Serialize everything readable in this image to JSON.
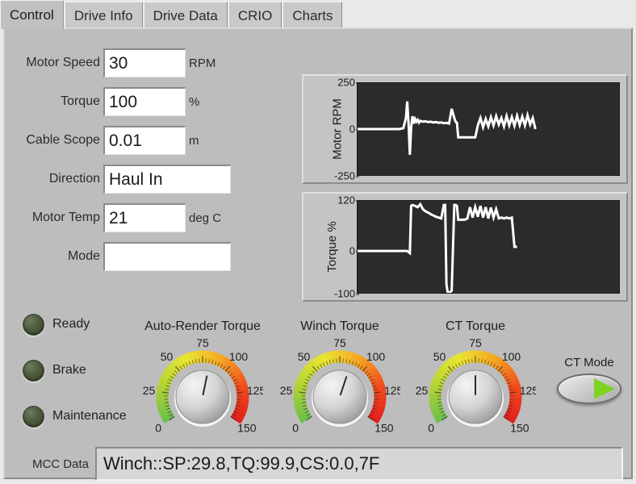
{
  "tabs": [
    {
      "label": "Control",
      "active": true
    },
    {
      "label": "Drive Info",
      "active": false
    },
    {
      "label": "Drive Data",
      "active": false
    },
    {
      "label": "CRIO",
      "active": false
    },
    {
      "label": "Charts",
      "active": false
    }
  ],
  "form": {
    "rows": [
      {
        "label": "Motor Speed",
        "value": "30",
        "unit": "RPM",
        "width": "narrow"
      },
      {
        "label": "Torque",
        "value": "100",
        "unit": "%",
        "width": "narrow"
      },
      {
        "label": "Cable Scope",
        "value": "0.01",
        "unit": "m",
        "width": "narrow"
      },
      {
        "label": "Direction",
        "value": "Haul In",
        "unit": "",
        "width": "wide"
      },
      {
        "label": "Motor Temp",
        "value": "21",
        "unit": "deg C",
        "width": "narrow"
      },
      {
        "label": "Mode",
        "value": "",
        "unit": "",
        "width": "wide"
      }
    ]
  },
  "leds": [
    {
      "label": "Ready",
      "state": "off",
      "color": "#4e5b3f"
    },
    {
      "label": "Brake",
      "state": "off",
      "color": "#4e5b3f"
    },
    {
      "label": "Maintenance",
      "state": "off",
      "color": "#4e5b3f"
    }
  ],
  "gauges": [
    {
      "title": "Auto-Render Torque",
      "min": 0,
      "max": 150,
      "value": 82,
      "ticks": [
        "0",
        "25",
        "50",
        "75",
        "100",
        "125",
        "150"
      ],
      "arc_colors": [
        "#6cc04a",
        "#b6d334",
        "#e9e533",
        "#f6a623",
        "#ef4b1e",
        "#e01b1b"
      ]
    },
    {
      "title": "Winch Torque",
      "min": 0,
      "max": 150,
      "value": 86,
      "ticks": [
        "0",
        "25",
        "50",
        "75",
        "100",
        "125",
        "150"
      ],
      "arc_colors": [
        "#6cc04a",
        "#b6d334",
        "#e9e533",
        "#f6a623",
        "#ef4b1e",
        "#e01b1b"
      ]
    },
    {
      "title": "CT Torque",
      "min": 0,
      "max": 150,
      "value": 75,
      "ticks": [
        "0",
        "25",
        "50",
        "75",
        "100",
        "125",
        "150"
      ],
      "arc_colors": [
        "#6cc04a",
        "#b6d334",
        "#e9e533",
        "#f6a623",
        "#ef4b1e",
        "#e01b1b"
      ]
    }
  ],
  "ct_mode": {
    "label": "CT Mode",
    "state": "on",
    "indicator_color": "#7ed321"
  },
  "mcc": {
    "label": "MCC Data",
    "value": "Winch::SP:29.8,TQ:99.9,CS:0.0,7F"
  },
  "chart_data": [
    {
      "type": "line",
      "name": "motor-rpm-chart",
      "title": "",
      "ylabel": "Motor RPM",
      "xlabel": "",
      "ylim": [
        -250,
        250
      ],
      "yticks": [
        250,
        0,
        -250
      ],
      "ytick_labels": [
        "250",
        "0",
        "-250"
      ],
      "grid": false,
      "trace_color": "#ffffff",
      "background": "#2b2b2b",
      "x": [
        0,
        0.04,
        0.08,
        0.12,
        0.16,
        0.175,
        0.185,
        0.19,
        0.195,
        0.2,
        0.205,
        0.21,
        0.215,
        0.22,
        0.225,
        0.23,
        0.235,
        0.24,
        0.25,
        0.26,
        0.27,
        0.28,
        0.29,
        0.3,
        0.31,
        0.32,
        0.33,
        0.34,
        0.35,
        0.36,
        0.37,
        0.375,
        0.38,
        0.385,
        0.39,
        0.4,
        0.41,
        0.42,
        0.43,
        0.44,
        0.45,
        0.46,
        0.47,
        0.48,
        0.49,
        0.5,
        0.51,
        0.52,
        0.53,
        0.54,
        0.55,
        0.56,
        0.57,
        0.58,
        0.59,
        0.6,
        0.61,
        0.62,
        0.63,
        0.64,
        0.65,
        0.66,
        0.67,
        0.68
      ],
      "y": [
        0,
        0,
        0,
        0,
        0,
        5,
        60,
        150,
        30,
        -140,
        10,
        70,
        30,
        55,
        40,
        50,
        35,
        45,
        40,
        42,
        38,
        40,
        36,
        38,
        34,
        36,
        32,
        34,
        30,
        110,
        60,
        40,
        35,
        -45,
        -45,
        -45,
        -45,
        -45,
        -45,
        -45,
        -45,
        20,
        60,
        10,
        55,
        15,
        65,
        20,
        70,
        25,
        60,
        15,
        70,
        20,
        65,
        18,
        72,
        22,
        68,
        20,
        75,
        25,
        60,
        0
      ]
    },
    {
      "type": "line",
      "name": "torque-percent-chart",
      "title": "",
      "ylabel": "Torque %",
      "xlabel": "",
      "ylim": [
        -100,
        120
      ],
      "yticks": [
        120,
        0,
        -100
      ],
      "ytick_labels": [
        "120",
        "0",
        "-100"
      ],
      "grid": false,
      "trace_color": "#ffffff",
      "background": "#2b2b2b",
      "x": [
        0,
        0.05,
        0.1,
        0.15,
        0.19,
        0.2,
        0.205,
        0.21,
        0.22,
        0.23,
        0.24,
        0.25,
        0.26,
        0.27,
        0.28,
        0.29,
        0.3,
        0.31,
        0.32,
        0.33,
        0.335,
        0.34,
        0.345,
        0.35,
        0.36,
        0.37,
        0.375,
        0.38,
        0.385,
        0.39,
        0.4,
        0.41,
        0.42,
        0.43,
        0.44,
        0.45,
        0.46,
        0.47,
        0.48,
        0.49,
        0.5,
        0.51,
        0.52,
        0.53,
        0.54,
        0.55,
        0.56,
        0.57,
        0.58,
        0.59,
        0.6,
        0.61
      ],
      "y": [
        0,
        0,
        0,
        0,
        0,
        -5,
        108,
        110,
        108,
        105,
        112,
        100,
        95,
        92,
        88,
        85,
        82,
        80,
        78,
        110,
        110,
        -80,
        -100,
        -100,
        -95,
        110,
        110,
        108,
        75,
        75,
        75,
        75,
        78,
        105,
        80,
        105,
        82,
        108,
        80,
        105,
        78,
        104,
        80,
        100,
        78,
        80,
        78,
        80,
        78,
        80,
        10,
        10
      ]
    }
  ]
}
